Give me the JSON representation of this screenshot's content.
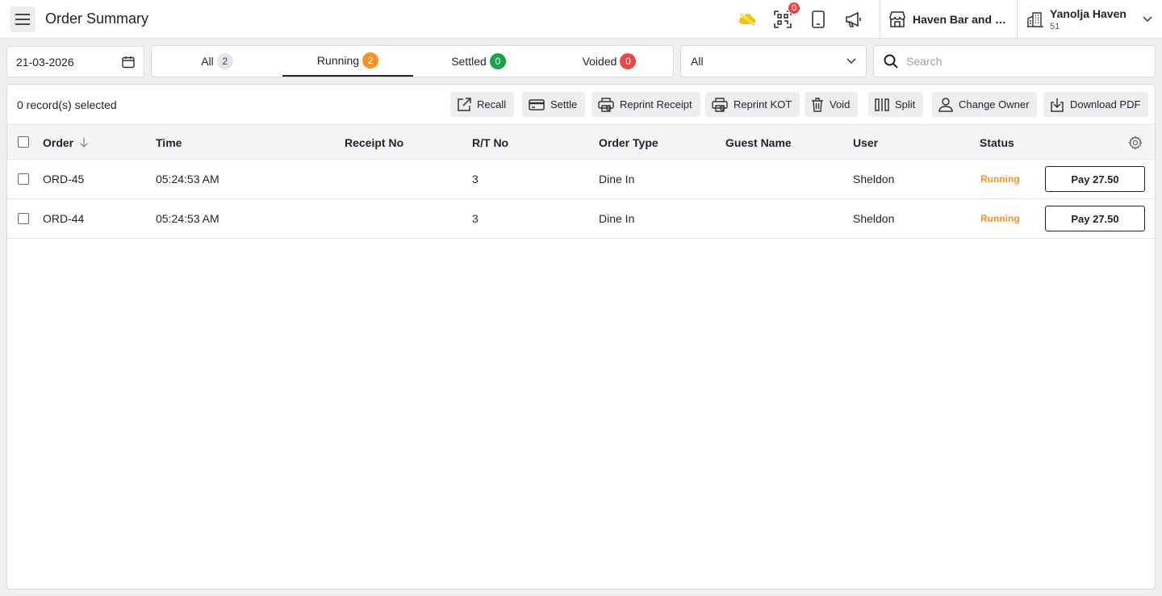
{
  "header": {
    "title": "Order Summary",
    "notification_count": "0",
    "venue_name": "Haven Bar and Restaurant",
    "account_name": "Yanolja Haven",
    "account_sub": "51"
  },
  "filters": {
    "date": "21-03-2026",
    "tabs": [
      {
        "label": "All",
        "count": "2",
        "badge_color": "#e3e5e8",
        "badge_text_color": "#444444"
      },
      {
        "label": "Running",
        "count": "2",
        "badge_color": "#f7931e",
        "badge_text_color": "#ffffff"
      },
      {
        "label": "Settled",
        "count": "0",
        "badge_color": "#16a34a",
        "badge_text_color": "#ffffff"
      },
      {
        "label": "Voided",
        "count": "0",
        "badge_color": "#ef4444",
        "badge_text_color": "#ffffff"
      }
    ],
    "active_tab": "Running",
    "type_select": "All",
    "search_placeholder": "Search"
  },
  "toolbar": {
    "selected_text": "0 record(s) selected",
    "actions": [
      {
        "label": "Recall",
        "icon": "external-link-icon"
      },
      {
        "label": "Settle",
        "icon": "card-icon"
      },
      {
        "label": "Reprint Receipt",
        "icon": "printer-icon"
      },
      {
        "label": "Reprint KOT",
        "icon": "printer-icon"
      },
      {
        "label": "Void",
        "icon": "trash-icon"
      },
      {
        "label": "Split",
        "icon": "split-icon"
      },
      {
        "label": "Change Owner",
        "icon": "user-icon"
      },
      {
        "label": "Download PDF",
        "icon": "download-icon"
      }
    ]
  },
  "table": {
    "columns": [
      "Order",
      "Time",
      "Receipt No",
      "R/T No",
      "Order Type",
      "Guest Name",
      "User",
      "Status"
    ],
    "rows": [
      {
        "order": "ORD-45",
        "time": "05:24:53 AM",
        "receipt": "",
        "rt": "3",
        "type": "Dine In",
        "guest": "",
        "user": "Sheldon",
        "status": "Running",
        "pay": "Pay 27.50"
      },
      {
        "order": "ORD-44",
        "time": "05:24:53 AM",
        "receipt": "",
        "rt": "3",
        "type": "Dine In",
        "guest": "",
        "user": "Sheldon",
        "status": "Running",
        "pay": "Pay 27.50"
      }
    ]
  },
  "colors": {
    "running": "#f7931e",
    "cloud_icon": "#f5c400",
    "badge_red": "#ef4444"
  }
}
